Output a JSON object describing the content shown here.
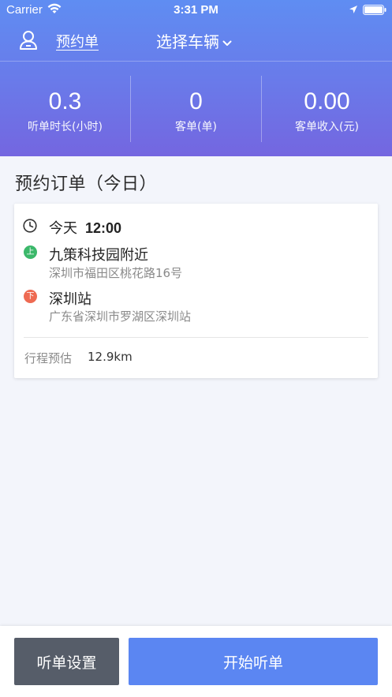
{
  "status_bar": {
    "carrier": "Carrier",
    "time": "3:31 PM"
  },
  "nav": {
    "orders_label": "预约单",
    "vehicle_label": "选择车辆"
  },
  "stats": [
    {
      "value": "0.3",
      "label": "听单时长(小时)"
    },
    {
      "value": "0",
      "label": "客单(单)"
    },
    {
      "value": "0.00",
      "label": "客单收入(元)"
    }
  ],
  "section_title": "预约订单（今日）",
  "order": {
    "day": "今天",
    "time": "12:00",
    "pickup_badge": "上",
    "pickup_name": "九策科技园附近",
    "pickup_address": "深圳市福田区桃花路16号",
    "dropoff_badge": "下",
    "dropoff_name": "深圳站",
    "dropoff_address": "广东省深圳市罗湖区深圳站",
    "estimate_label": "行程预估",
    "estimate_value": "12.9km"
  },
  "buttons": {
    "settings": "听单设置",
    "start": "开始听单"
  },
  "icons": {
    "wifi": "wifi-icon",
    "location": "location-arrow-icon",
    "battery": "battery-icon",
    "user": "user-icon",
    "chevron": "chevron-down-icon",
    "clock": "clock-icon"
  },
  "colors": {
    "header_top": "#5f8df2",
    "header_bottom": "#7466e0",
    "pickup_badge": "#3bb86a",
    "dropoff_badge": "#ee6a52",
    "settings_button": "#565d69",
    "start_button": "#5b86f2"
  }
}
